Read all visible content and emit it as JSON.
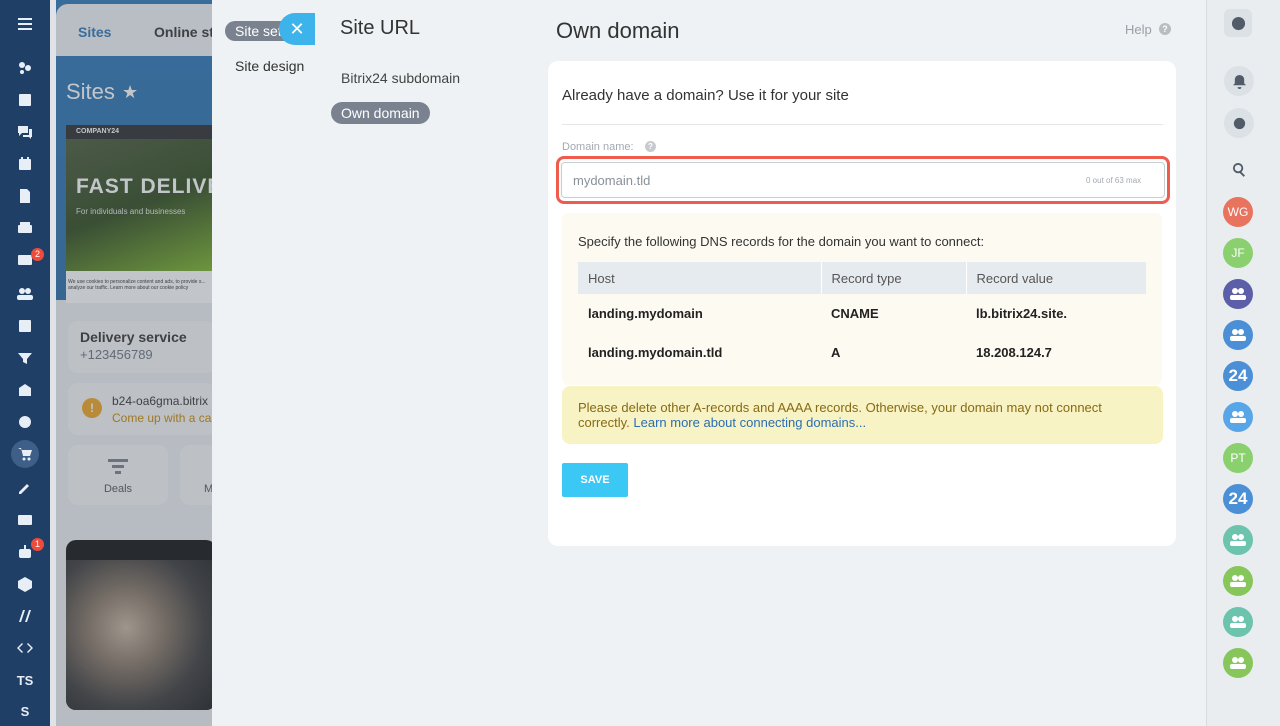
{
  "left_rail": {
    "mail_badge": "2",
    "bot_badge": "1",
    "ts_label": "TS",
    "s_label": "S"
  },
  "sites_page": {
    "tabs": [
      "Sites",
      "Online st"
    ],
    "title": "Sites",
    "site_card": {
      "brand": "COMPANY24",
      "headline": "FAST DELIVE",
      "subtitle": "For individuals and businesses",
      "cookie_text": "We use cookies to personalize content and ads, to provide s... analyze our traffic. Learn more about our cookie policy"
    },
    "delivery": {
      "name": "Delivery service",
      "phone": "+123456789"
    },
    "warning": {
      "domain": "b24-oa6gma.bitrix",
      "hint": "Come up with a ca"
    },
    "deals_label": "Deals",
    "other_label": "M"
  },
  "settings_nav": {
    "active_tab": "Site settings",
    "site_design": "Site design"
  },
  "panel": {
    "title": "Site URL",
    "side_items": [
      {
        "label": "Bitrix24 subdomain",
        "active": false
      },
      {
        "label": "Own domain",
        "active": true
      }
    ],
    "content_title": "Own domain",
    "help": "Help",
    "card": {
      "heading": "Already have a domain? Use it for your site",
      "field_label": "Domain name:",
      "input_placeholder": "mydomain.tld",
      "input_value": "",
      "char_counter": "0 out of 63 max",
      "dns_caption": "Specify the following DNS records for the domain you want to connect:",
      "dns_columns": [
        "Host",
        "Record type",
        "Record value"
      ],
      "dns_rows": [
        [
          "landing.mydomain",
          "CNAME",
          "lb.bitrix24.site."
        ],
        [
          "landing.mydomain.tld",
          "A",
          "18.208.124.7"
        ]
      ],
      "alert_text": "Please delete other A-records and AAAA records. Otherwise, your domain may not connect correctly. ",
      "alert_link": "Learn more about connecting domains...",
      "save_label": "SAVE"
    }
  },
  "right_rail": {
    "avatars": [
      {
        "initials": "WG",
        "color": "#e8735e"
      },
      {
        "initials": "JF",
        "color": "#8bd06e"
      },
      {
        "initials": "",
        "color": "#5a5fa8"
      },
      {
        "initials": "",
        "color": "#4b8fd6"
      },
      {
        "initials": "24",
        "color": "#4b8fd6"
      },
      {
        "initials": "",
        "color": "#58a6e8"
      },
      {
        "initials": "PT",
        "color": "#8bd06e"
      },
      {
        "initials": "24",
        "color": "#4b8fd6"
      },
      {
        "initials": "",
        "color": "#6cc3ae"
      },
      {
        "initials": "",
        "color": "#86c65a"
      },
      {
        "initials": "",
        "color": "#6cc3ae"
      },
      {
        "initials": "",
        "color": "#86c65a"
      }
    ]
  },
  "colors": {
    "accent": "#3bc8f5",
    "highlight": "#ef5b4d",
    "alert_bg": "#f8f3c4",
    "left_rail": "#1f3f66"
  }
}
